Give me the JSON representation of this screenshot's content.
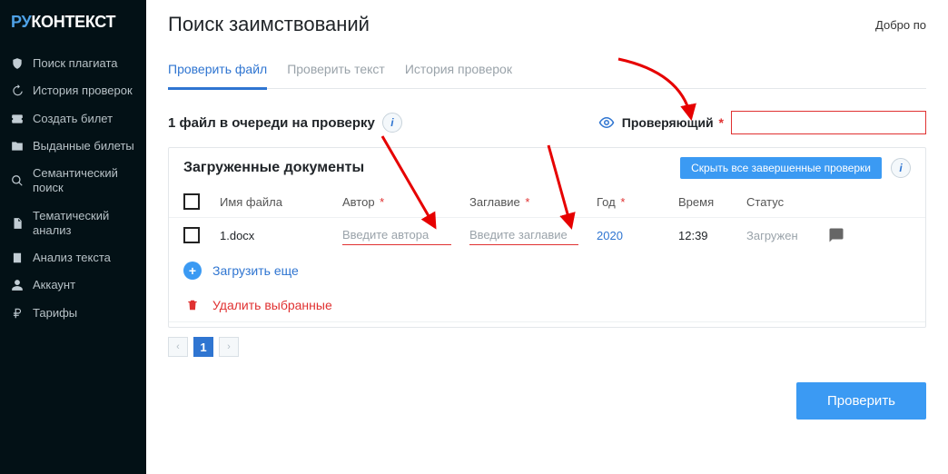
{
  "brand": {
    "ru": "РУ",
    "context": "КОНТЕКСТ"
  },
  "sidebar": {
    "items": [
      {
        "label": "Поиск плагиата"
      },
      {
        "label": "История проверок"
      },
      {
        "label": "Создать билет"
      },
      {
        "label": "Выданные билеты"
      },
      {
        "label": "Семантический поиск"
      },
      {
        "label": "Тематический анализ"
      },
      {
        "label": "Анализ текста"
      },
      {
        "label": "Аккаунт"
      },
      {
        "label": "Тарифы"
      }
    ]
  },
  "header": {
    "title": "Поиск заимствований",
    "welcome": "Добро по"
  },
  "tabs": [
    {
      "label": "Проверить файл",
      "active": true
    },
    {
      "label": "Проверить текст",
      "active": false
    },
    {
      "label": "История проверок",
      "active": false
    }
  ],
  "queue": {
    "text": "1 файл в очереди на проверку"
  },
  "reviewer": {
    "label": "Проверяющий",
    "value": ""
  },
  "table": {
    "title": "Загруженные документы",
    "hide_button": "Скрыть все завершенные проверки",
    "columns": {
      "filename": "Имя файла",
      "author": "Автор",
      "title": "Заглавие",
      "year": "Год",
      "time": "Время",
      "status": "Статус"
    },
    "rows": [
      {
        "filename": "1.docx",
        "author_placeholder": "Введите автора",
        "title_placeholder": "Введите заглавие",
        "year": "2020",
        "time": "12:39",
        "status": "Загружен"
      }
    ],
    "upload_more": "Загрузить еще",
    "delete_selected": "Удалить выбранные"
  },
  "pagination": {
    "current": "1"
  },
  "submit": {
    "label": "Проверить"
  }
}
